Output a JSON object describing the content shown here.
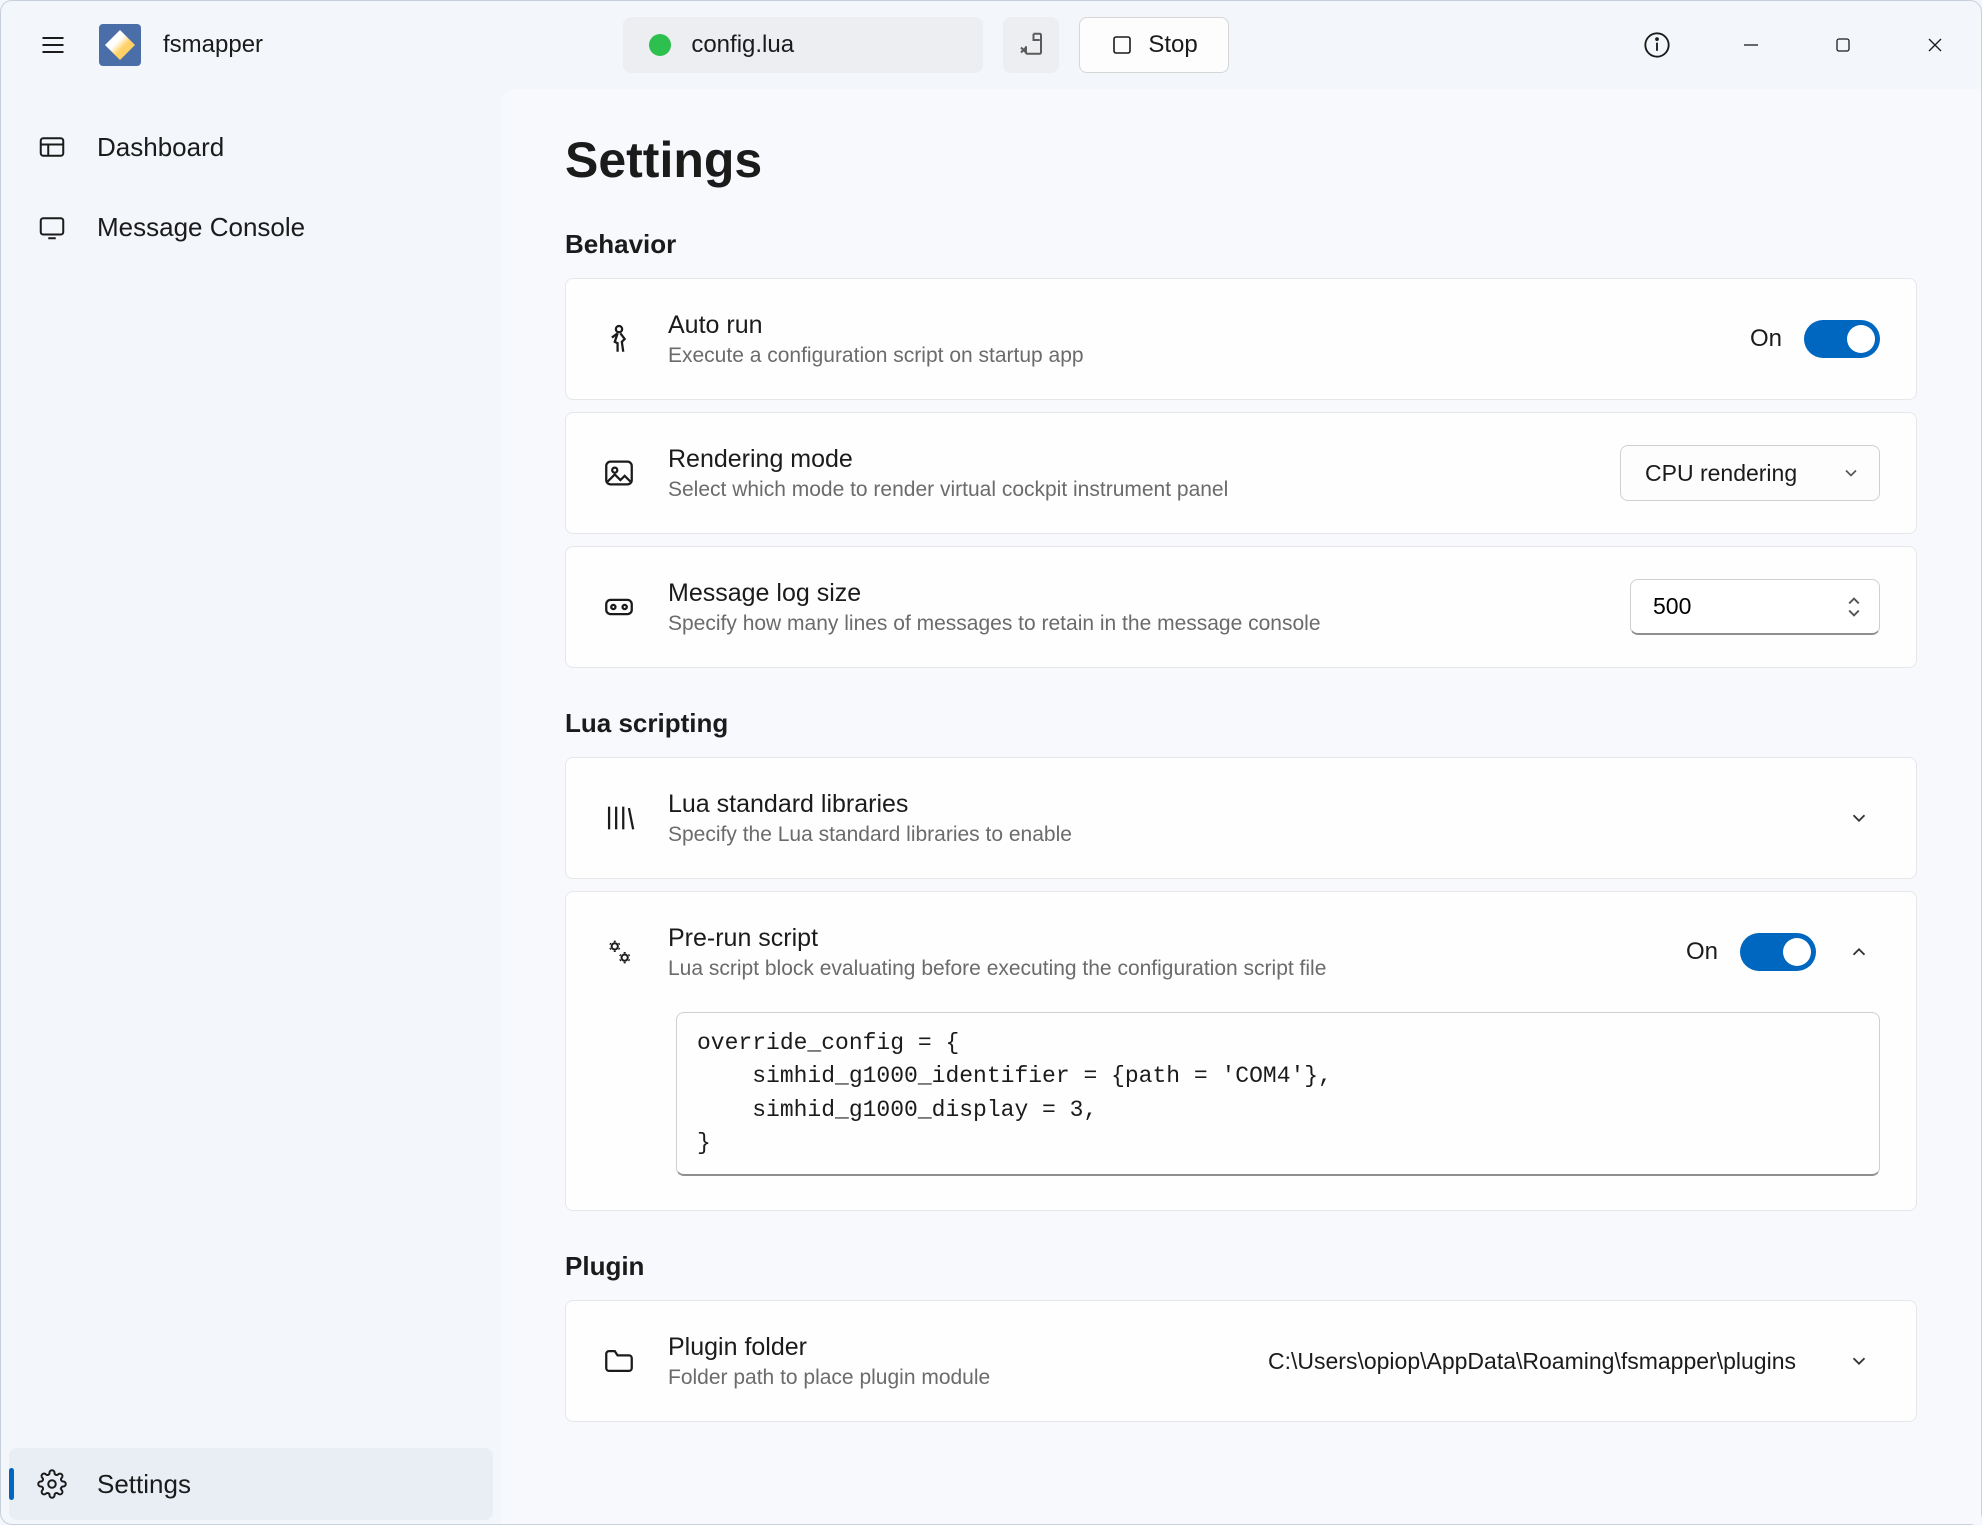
{
  "app": {
    "title": "fsmapper",
    "file_name": "config.lua",
    "stop_label": "Stop"
  },
  "sidebar": {
    "items": [
      {
        "label": "Dashboard"
      },
      {
        "label": "Message Console"
      },
      {
        "label": "Settings"
      }
    ]
  },
  "main": {
    "title": "Settings",
    "sections": {
      "behavior": {
        "title": "Behavior",
        "auto_run": {
          "title": "Auto run",
          "desc": "Execute a configuration script on startup app",
          "state_label": "On"
        },
        "rendering_mode": {
          "title": "Rendering mode",
          "desc": "Select which mode to render virtual cockpit instrument panel",
          "value": "CPU rendering"
        },
        "msg_log_size": {
          "title": "Message log size",
          "desc": "Specify how many lines of messages to retain in the message console",
          "value": "500"
        }
      },
      "lua": {
        "title": "Lua scripting",
        "std_libs": {
          "title": "Lua standard libraries",
          "desc": "Specify the Lua standard libraries to enable"
        },
        "prerun": {
          "title": "Pre-run script",
          "desc": "Lua script block evaluating before executing the configuration script file",
          "state_label": "On",
          "code": "override_config = {\n    simhid_g1000_identifier = {path = 'COM4'},\n    simhid_g1000_display = 3,\n}"
        }
      },
      "plugin": {
        "title": "Plugin",
        "folder": {
          "title": "Plugin folder",
          "desc": "Folder path to place plugin module",
          "path": "C:\\Users\\opiop\\AppData\\Roaming\\fsmapper\\plugins"
        }
      }
    }
  }
}
